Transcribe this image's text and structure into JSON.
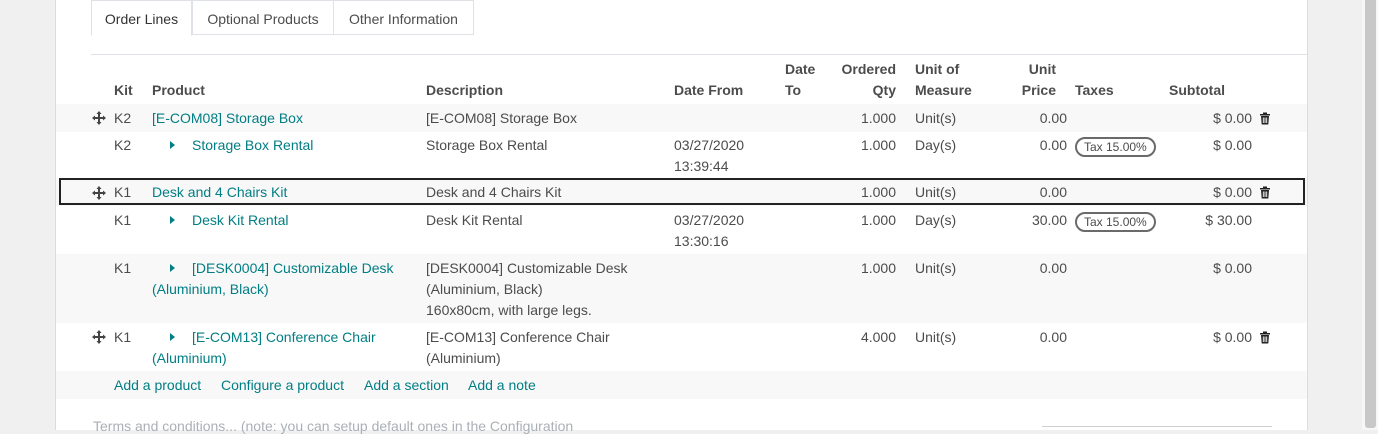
{
  "tabs": [
    "Order Lines",
    "Optional Products",
    "Other Information"
  ],
  "columns": {
    "kit": "Kit",
    "product": "Product",
    "description": "Description",
    "date_from": "Date From",
    "date_to_1": "Date",
    "date_to_2": "To",
    "qty_1": "Ordered",
    "qty_2": "Qty",
    "uom_1": "Unit of",
    "uom_2": "Measure",
    "price_1": "Unit",
    "price_2": "Price",
    "taxes": "Taxes",
    "subtotal": "Subtotal"
  },
  "rows": [
    {
      "kit": "K2",
      "product": "[E-COM08] Storage Box",
      "desc1": "[E-COM08] Storage Box",
      "qty": "1.000",
      "uom": "Unit(s)",
      "price": "0.00",
      "subtotal": "$ 0.00"
    },
    {
      "kit": "K2",
      "product": "Storage Box Rental",
      "desc1": "Storage Box Rental",
      "date1": "03/27/2020",
      "date2": "13:39:44",
      "qty": "1.000",
      "uom": "Day(s)",
      "price": "0.00",
      "tax": "Tax 15.00%",
      "subtotal": "$ 0.00"
    },
    {
      "kit": "K1",
      "product": "Desk and 4 Chairs Kit",
      "desc1": "Desk and 4 Chairs Kit",
      "qty": "1.000",
      "uom": "Unit(s)",
      "price": "0.00",
      "subtotal": "$ 0.00"
    },
    {
      "kit": "K1",
      "product": "Desk Kit Rental",
      "desc1": "Desk Kit Rental",
      "date1": "03/27/2020",
      "date2": "13:30:16",
      "qty": "1.000",
      "uom": "Day(s)",
      "price": "30.00",
      "tax": "Tax 15.00%",
      "subtotal": "$ 30.00"
    },
    {
      "kit": "K1",
      "product1": "[DESK0004] Customizable Desk",
      "product2": "(Aluminium, Black)",
      "desc1": "[DESK0004] Customizable Desk",
      "desc2": "(Aluminium, Black)",
      "desc3": "160x80cm, with large legs.",
      "qty": "1.000",
      "uom": "Unit(s)",
      "price": "0.00",
      "subtotal": "$ 0.00"
    },
    {
      "kit": "K1",
      "product1": "[E-COM13] Conference Chair",
      "product2": "(Aluminium)",
      "desc1": "[E-COM13] Conference Chair",
      "desc2": "(Aluminium)",
      "qty": "4.000",
      "uom": "Unit(s)",
      "price": "0.00",
      "subtotal": "$ 0.00"
    }
  ],
  "add_links": [
    "Add a product",
    "Configure a product",
    "Add a section",
    "Add a note"
  ],
  "footer_text": "Terms and conditions... (note: you can setup default ones in the Configuration",
  "icons": {
    "drag": "drag-handle-icon",
    "trash": "trash-icon",
    "caret": "caret-right-icon"
  },
  "colors": {
    "link": "#017e84",
    "text": "#4c4c4c"
  }
}
